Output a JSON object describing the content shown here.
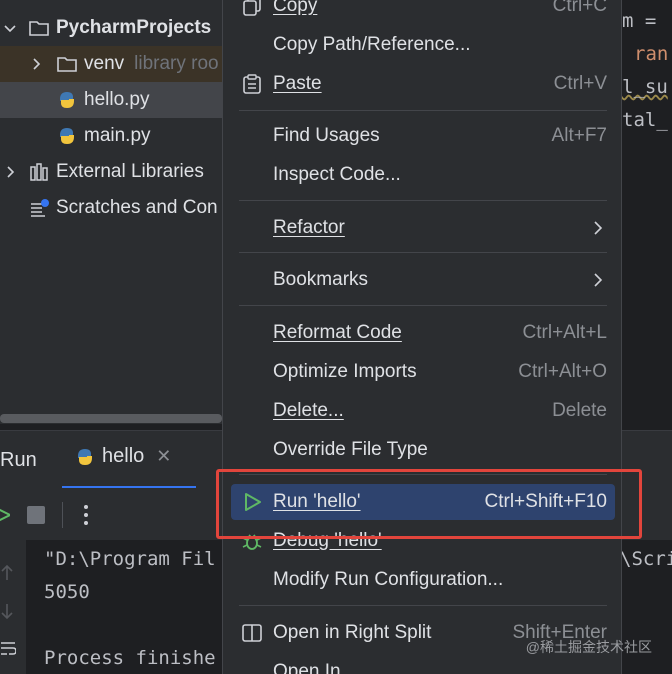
{
  "project_tree": {
    "root_label": "PycharmProjects",
    "venv_label": "venv",
    "venv_hint": "library roo",
    "file1": "hello.py",
    "file2": "main.py",
    "external_libraries": "External Libraries",
    "scratches": "Scratches and Con"
  },
  "editor": {
    "line1": "m =",
    "line2_kw": "ran",
    "line3": "l_su",
    "line4": "tal_"
  },
  "run_window": {
    "title": "Run",
    "tab_label": "hello",
    "console_line1": "\"D:\\Program Fil",
    "console_line1_right": "\\Scri",
    "console_line2": "5050",
    "console_line3": "Process finishe"
  },
  "context_menu": {
    "copy": {
      "label": "Copy",
      "shortcut": "Ctrl+C"
    },
    "copy_path": {
      "label": "Copy Path/Reference..."
    },
    "paste": {
      "label": "Paste",
      "shortcut": "Ctrl+V"
    },
    "find_usages": {
      "label": "Find Usages",
      "shortcut": "Alt+F7"
    },
    "inspect_code": {
      "label": "Inspect Code..."
    },
    "refactor": {
      "label": "Refactor"
    },
    "bookmarks": {
      "label": "Bookmarks"
    },
    "reformat_code": {
      "label": "Reformat Code",
      "shortcut": "Ctrl+Alt+L"
    },
    "optimize_imports": {
      "label": "Optimize Imports",
      "shortcut": "Ctrl+Alt+O"
    },
    "delete": {
      "label": "Delete...",
      "shortcut": "Delete"
    },
    "override_file_type": {
      "label": "Override File Type"
    },
    "run": {
      "label": "Run 'hello'",
      "shortcut": "Ctrl+Shift+F10"
    },
    "debug": {
      "label": "Debug 'hello'"
    },
    "modify_run_config": {
      "label": "Modify Run Configuration..."
    },
    "open_right_split": {
      "label": "Open in Right Split",
      "shortcut": "Shift+Enter"
    },
    "open_in": {
      "label": "Open In"
    }
  },
  "watermark": "@稀土掘金技术社区",
  "colors": {
    "highlight_border": "#e2453c",
    "selection": "#2e436e",
    "accent": "#3574f0"
  }
}
